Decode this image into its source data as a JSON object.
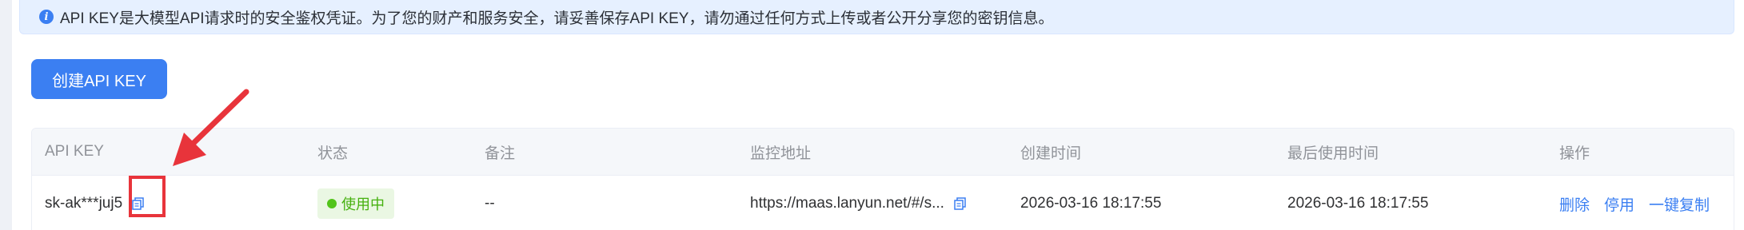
{
  "notice": {
    "text": "API KEY是大模型API请求时的安全鉴权凭证。为了您的财产和服务安全，请妥善保存API KEY，请勿通过任何方式上传或者公开分享您的密钥信息。"
  },
  "toolbar": {
    "create_label": "创建API KEY"
  },
  "table": {
    "headers": [
      "API KEY",
      "状态",
      "备注",
      "监控地址",
      "创建时间",
      "最后使用时间",
      "操作"
    ],
    "rows": [
      {
        "api_key": "sk-ak***juj5",
        "status": "使用中",
        "remark": "--",
        "monitor_url": "https://maas.lanyun.net/#/s...",
        "created": "2026-03-16 18:17:55",
        "last_used": "2026-03-16 18:17:55",
        "actions": [
          "删除",
          "停用",
          "一键复制"
        ]
      }
    ]
  },
  "colors": {
    "accent": "#3b7ff2",
    "highlight": "#e8343b",
    "status_green": "#52c41a"
  },
  "icons": {
    "info": "info-icon",
    "copy": "copy-icon",
    "annotation": "red-arrow"
  }
}
